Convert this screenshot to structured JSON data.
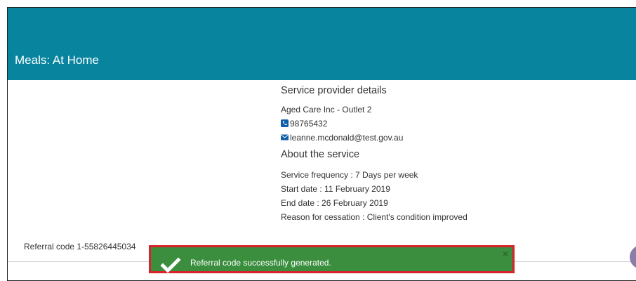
{
  "header": {
    "title": "Meals: At Home",
    "color": "#08849e"
  },
  "provider": {
    "heading": "Service provider details",
    "name": "Aged Care Inc - Outlet 2",
    "phone": "98765432",
    "email": "leanne.mcdonald@test.gov.au"
  },
  "service": {
    "heading": "About the service",
    "frequency": "Service frequency : 7 Days per week",
    "start_date": "Start date : 11 February 2019",
    "end_date": "End date : 26 February 2019",
    "reason": "Reason for cessation : Client's condition improved"
  },
  "referral": {
    "text": "Referral code 1-55826445034"
  },
  "toast": {
    "message": "Referral code successfully generated.",
    "close_glyph": "×",
    "background": "#3a8e3d",
    "outline": "#d9222a"
  },
  "icons": {
    "phone": "phone-icon",
    "email": "envelope-icon",
    "success": "checkmark-icon",
    "close": "close-icon"
  }
}
